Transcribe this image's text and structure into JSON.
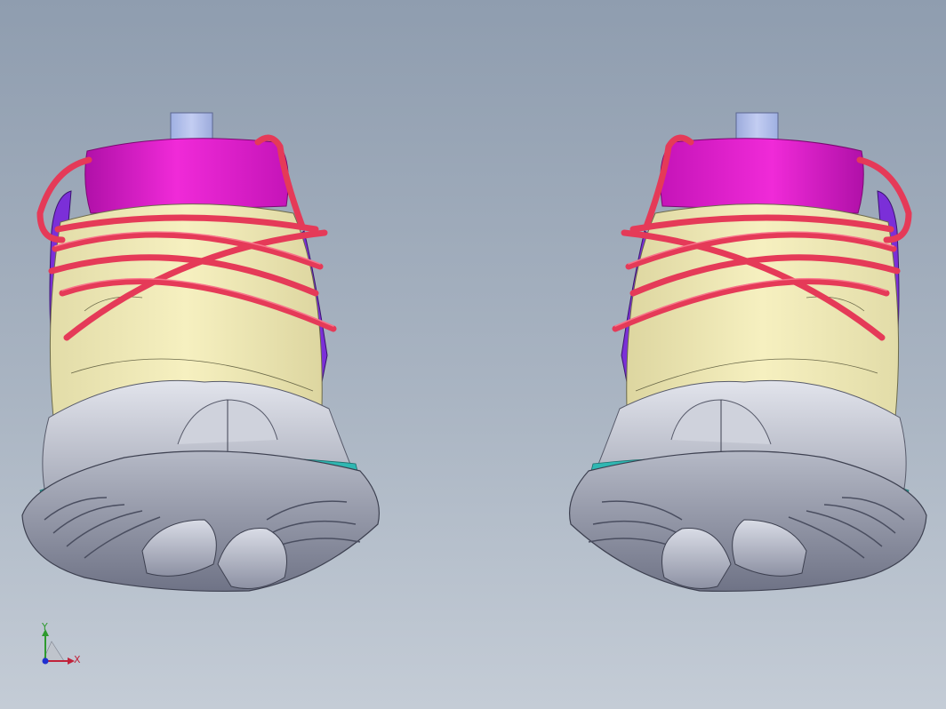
{
  "viewport": {
    "background_top": "#8f9daf",
    "background_bottom": "#c4ccd6"
  },
  "model": {
    "colors": {
      "collar": "#e21bd0",
      "tongue_tab": "#aab8e6",
      "upper": "#f1ebb4",
      "lace": "#e53a58",
      "side_trim": "#7b2fd8",
      "heel_counter": "#c3c6d2",
      "outsole": "#9a9fb0",
      "outsole_edge": "#2fb7b2"
    }
  },
  "triad": {
    "y_label": "Y",
    "x_label": "X",
    "y_color": "#2e9a2e",
    "x_color": "#c0223a",
    "z_color": "#2030d0"
  }
}
